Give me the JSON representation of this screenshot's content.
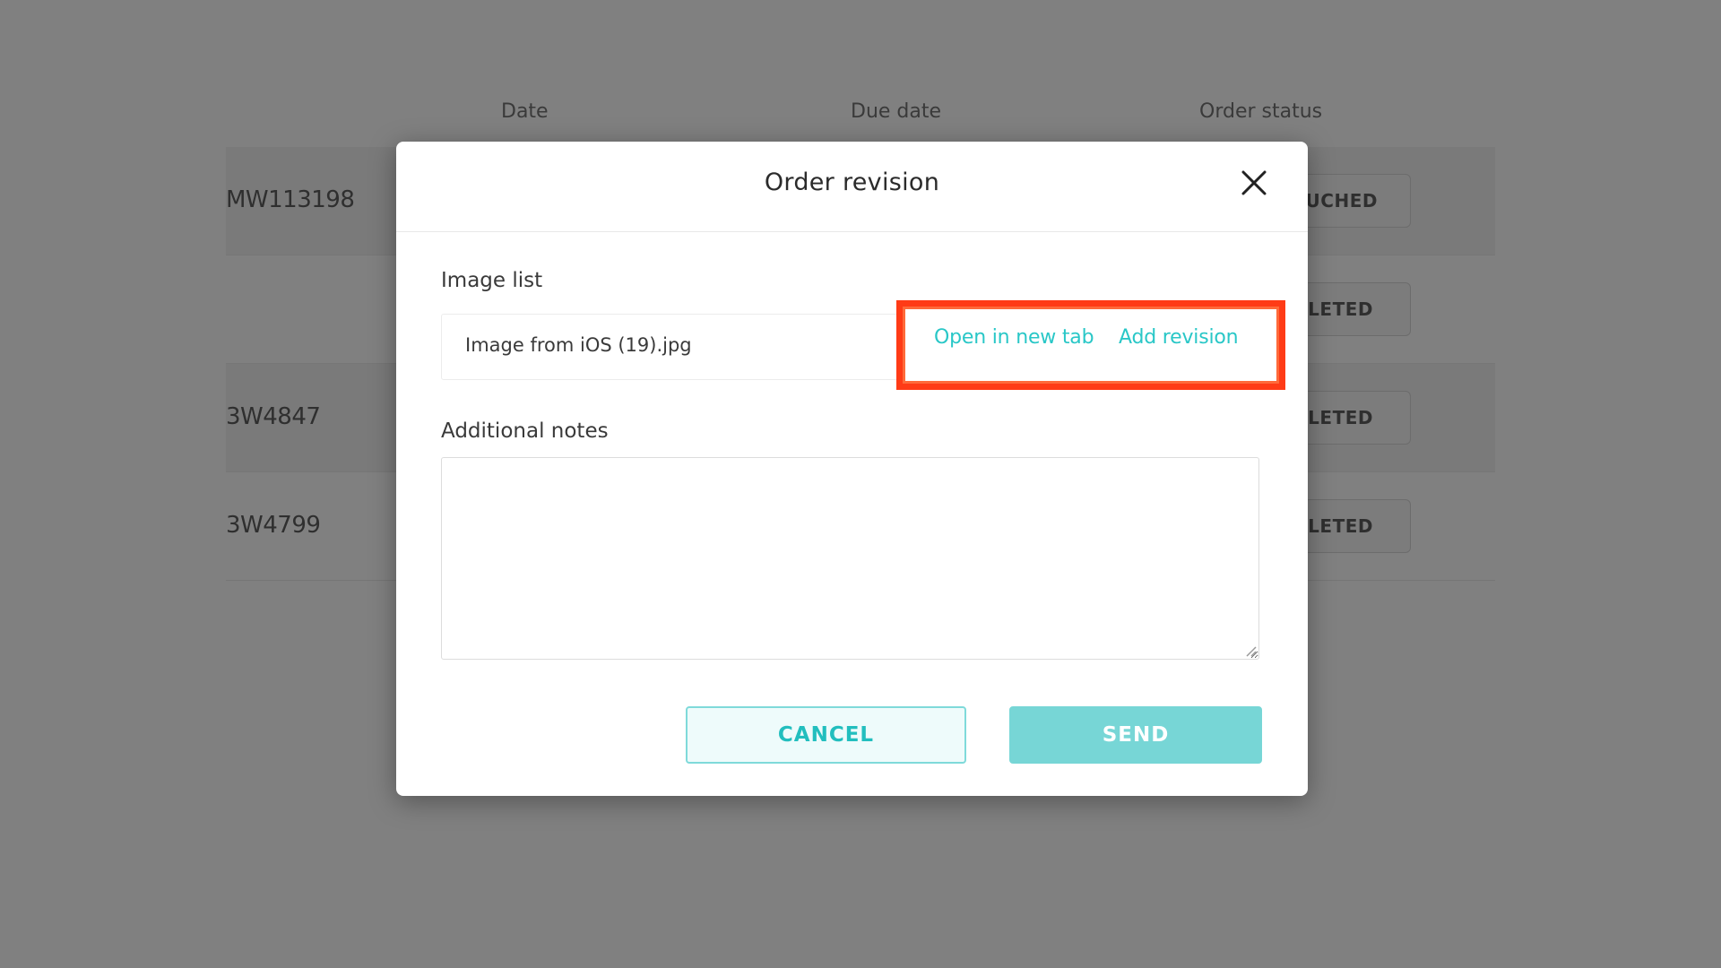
{
  "background_table": {
    "columns": [
      "Date",
      "Due date",
      "Order status"
    ],
    "rows": [
      {
        "order_id": "MW113198",
        "status": "OUCHED"
      },
      {
        "order_id": "",
        "status": "PLETED"
      },
      {
        "order_id": "3W4847",
        "status": "PLETED"
      },
      {
        "order_id": "3W4799",
        "status": "PLETED"
      }
    ]
  },
  "modal": {
    "title": "Order revision",
    "close_icon": "close-icon",
    "image_list_label": "Image list",
    "file": {
      "name": "Image from iOS (19).jpg",
      "open_link": "Open in new tab",
      "add_link": "Add revision"
    },
    "notes_label": "Additional notes",
    "notes_value": "",
    "cancel_label": "CANCEL",
    "send_label": "SEND"
  },
  "colors": {
    "accent": "#29c7c7",
    "highlight": "#ff3b16",
    "overlay": "#808080"
  }
}
